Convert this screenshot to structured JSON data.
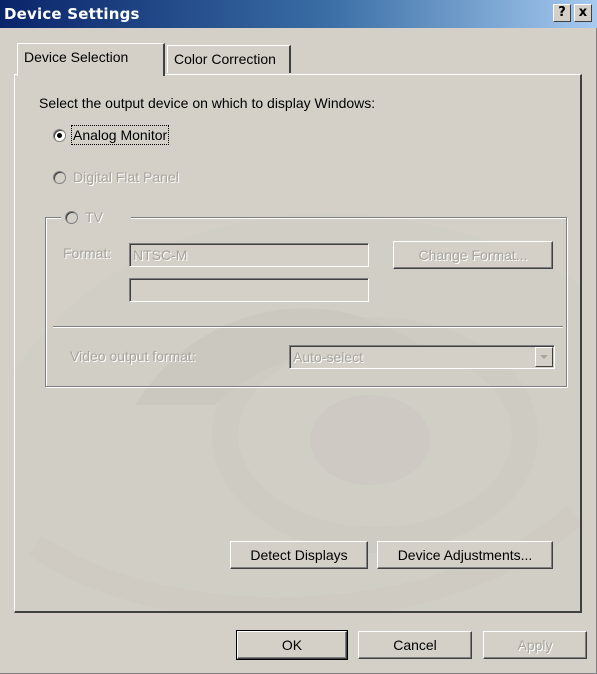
{
  "window": {
    "title": "Device Settings",
    "help_button": "?",
    "close_button": "x"
  },
  "tabs": [
    {
      "label": "Device Selection",
      "active": true
    },
    {
      "label": "Color Correction",
      "active": false
    }
  ],
  "panel": {
    "prompt": "Select the output device on which to display Windows:",
    "radios": {
      "analog": {
        "label": "Analog Monitor",
        "selected": true,
        "enabled": true
      },
      "digital": {
        "label": "Digital Flat Panel",
        "selected": false,
        "enabled": false
      },
      "tv": {
        "label": "TV",
        "selected": false,
        "enabled": false
      }
    },
    "tv_group": {
      "format_label": "Format:",
      "format_value": "NTSC-M",
      "format_second_value": "",
      "change_format_button": "Change Format...",
      "video_output_label": "Video output format:",
      "video_output_value": "Auto-select"
    },
    "detect_displays_button": "Detect Displays",
    "device_adjustments_button": "Device Adjustments..."
  },
  "footer": {
    "ok_button": "OK",
    "cancel_button": "Cancel",
    "apply_button": "Apply"
  },
  "colors": {
    "titlebar_start": "#0a246a",
    "titlebar_end": "#a6caf0",
    "face": "#d4d0c8",
    "disabled_text": "#a8a49c"
  }
}
